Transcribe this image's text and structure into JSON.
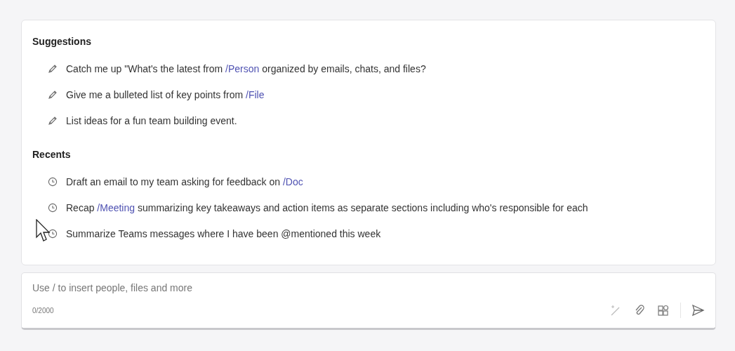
{
  "sections": [
    {
      "heading": "Suggestions",
      "items": [
        {
          "kind": "suggestion",
          "segments": [
            {
              "text": "Catch me up \"What's the latest from ",
              "link": false
            },
            {
              "text": "/Person",
              "link": true
            },
            {
              "text": " organized by emails, chats, and files?",
              "link": false
            }
          ]
        },
        {
          "kind": "suggestion",
          "segments": [
            {
              "text": "Give me a bulleted list of key points from ",
              "link": false
            },
            {
              "text": "/File",
              "link": true
            }
          ]
        },
        {
          "kind": "suggestion",
          "segments": [
            {
              "text": "List ideas for a fun team building event.",
              "link": false
            }
          ]
        }
      ]
    },
    {
      "heading": "Recents",
      "items": [
        {
          "kind": "recent",
          "segments": [
            {
              "text": "Draft an email to my team asking for feedback on ",
              "link": false
            },
            {
              "text": "/Doc",
              "link": true
            }
          ]
        },
        {
          "kind": "recent",
          "segments": [
            {
              "text": "Recap ",
              "link": false
            },
            {
              "text": "/Meeting",
              "link": true
            },
            {
              "text": " summarizing key takeaways and action items as separate sections including who's responsible for each",
              "link": false
            }
          ]
        },
        {
          "kind": "recent",
          "segments": [
            {
              "text": "Summarize Teams messages where I have been @mentioned this week",
              "link": false
            }
          ]
        }
      ]
    }
  ],
  "composer": {
    "placeholder": "Use / to insert people, files and more",
    "counter": "0/2000"
  }
}
